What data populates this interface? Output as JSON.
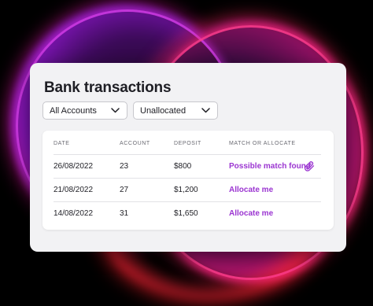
{
  "page": {
    "title": "Bank transactions"
  },
  "filters": {
    "accounts_value": "All Accounts",
    "status_value": "Unallocated"
  },
  "table": {
    "columns": [
      "DATE",
      "ACCOUNT",
      "DEPOSIT",
      "MATCH OR ALLOCATE"
    ],
    "rows": [
      {
        "date": "26/08/2022",
        "account": "23",
        "deposit": "$800",
        "action": "Possible match found",
        "icon": "paperclip-icon"
      },
      {
        "date": "21/08/2022",
        "account": "27",
        "deposit": "$1,200",
        "action": "Allocate me"
      },
      {
        "date": "14/08/2022",
        "account": "31",
        "deposit": "$1,650",
        "action": "Allocate me"
      }
    ]
  },
  "colors": {
    "accent": "#9b35d1",
    "card_bg": "#f2f2f4",
    "background": "#000000"
  }
}
